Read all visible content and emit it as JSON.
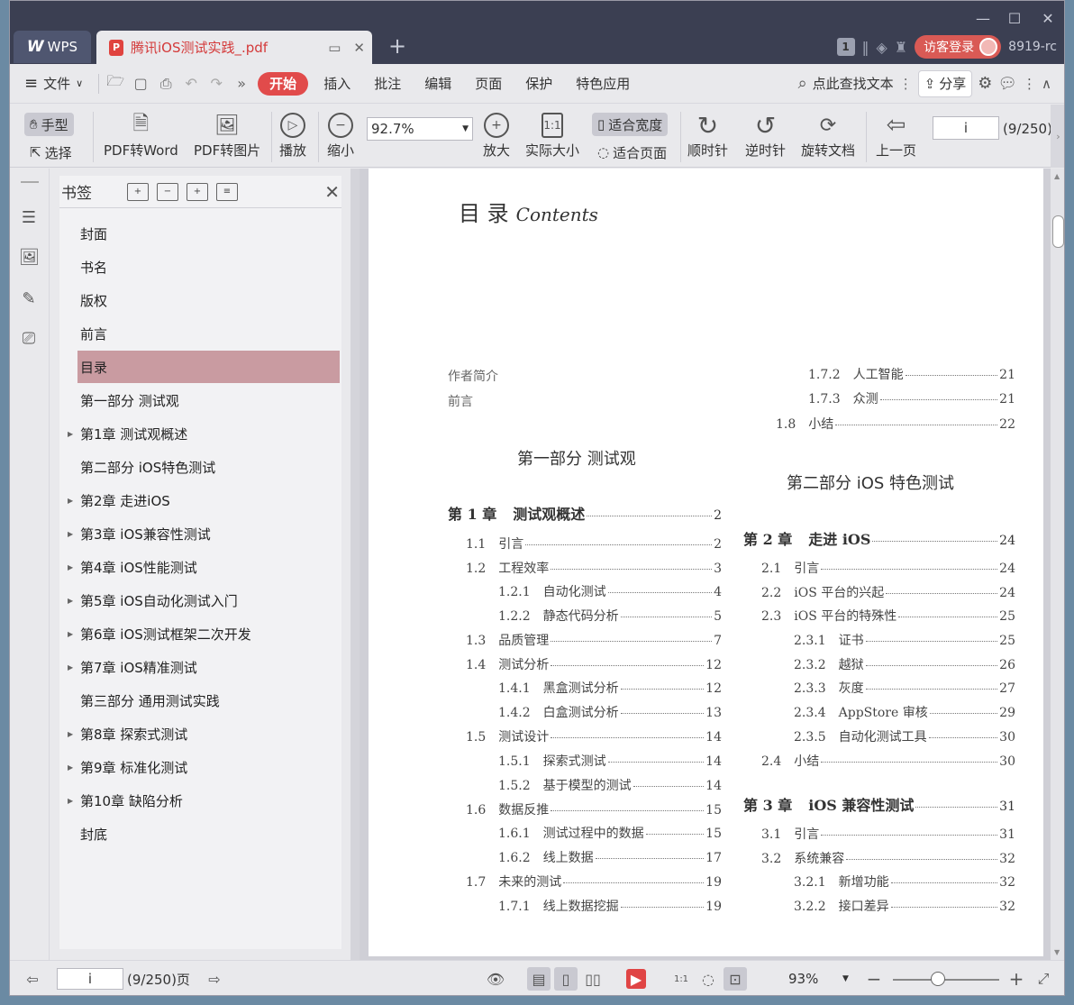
{
  "titlebar": {
    "app_tab": "WPS",
    "app_logo": "W",
    "doc_tab": "腾讯iOS测试实践_.pdf",
    "page_badge": "1",
    "login_label": "访客登录",
    "user": "8919-rc"
  },
  "menu": {
    "file": "文件",
    "tabs": [
      "开始",
      "插入",
      "批注",
      "编辑",
      "页面",
      "保护",
      "特色应用"
    ],
    "search": "点此查找文本",
    "share": "分享"
  },
  "toolbar": {
    "hand": "手型",
    "select": "选择",
    "pdf_to_word": "PDF转Word",
    "pdf_to_image": "PDF转图片",
    "play": "播放",
    "zoom_out": "缩小",
    "zoom_value": "92.7%",
    "zoom_in": "放大",
    "actual_size": "实际大小",
    "fit_width": "适合宽度",
    "fit_page": "适合页面",
    "clockwise": "顺时针",
    "counter_clockwise": "逆时针",
    "rotate_doc": "旋转文档",
    "prev_page": "上一页",
    "page_input": "i",
    "page_count": "(9/250)"
  },
  "bookmarks": {
    "title": "书签",
    "items": [
      {
        "label": "封面",
        "expandable": false
      },
      {
        "label": "书名",
        "expandable": false
      },
      {
        "label": "版权",
        "expandable": false
      },
      {
        "label": "前言",
        "expandable": false
      },
      {
        "label": "目录",
        "expandable": false,
        "selected": true
      },
      {
        "label": "第一部分  测试观",
        "expandable": false
      },
      {
        "label": "第1章  测试观概述",
        "expandable": true
      },
      {
        "label": "第二部分  iOS特色测试",
        "expandable": false
      },
      {
        "label": "第2章  走进iOS",
        "expandable": true
      },
      {
        "label": "第3章  iOS兼容性测试",
        "expandable": true
      },
      {
        "label": "第4章  iOS性能测试",
        "expandable": true
      },
      {
        "label": "第5章  iOS自动化测试入门",
        "expandable": true
      },
      {
        "label": "第6章  iOS测试框架二次开发",
        "expandable": true
      },
      {
        "label": "第7章  iOS精准测试",
        "expandable": true
      },
      {
        "label": "第三部分  通用测试实践",
        "expandable": false
      },
      {
        "label": "第8章  探索式测试",
        "expandable": true
      },
      {
        "label": "第9章  标准化测试",
        "expandable": true
      },
      {
        "label": "第10章  缺陷分析",
        "expandable": true
      },
      {
        "label": "封底",
        "expandable": false
      }
    ]
  },
  "page": {
    "title": "目    录",
    "title_en": "Contents",
    "left_pre": [
      "作者简介",
      "前言"
    ],
    "part1": "第一部分    测试观",
    "part2": "第二部分    iOS 特色测试",
    "left_toc": [
      {
        "num": "第 1 章",
        "text": "测试观概述",
        "page": "2",
        "level": 0
      },
      {
        "num": "1.1",
        "text": "引言",
        "page": "2",
        "level": 1
      },
      {
        "num": "1.2",
        "text": "工程效率",
        "page": "3",
        "level": 1
      },
      {
        "num": "1.2.1",
        "text": "自动化测试",
        "page": "4",
        "level": 2
      },
      {
        "num": "1.2.2",
        "text": "静态代码分析",
        "page": "5",
        "level": 2
      },
      {
        "num": "1.3",
        "text": "品质管理",
        "page": "7",
        "level": 1
      },
      {
        "num": "1.4",
        "text": "测试分析",
        "page": "12",
        "level": 1
      },
      {
        "num": "1.4.1",
        "text": "黑盒测试分析",
        "page": "12",
        "level": 2
      },
      {
        "num": "1.4.2",
        "text": "白盒测试分析",
        "page": "13",
        "level": 2
      },
      {
        "num": "1.5",
        "text": "测试设计",
        "page": "14",
        "level": 1
      },
      {
        "num": "1.5.1",
        "text": "探索式测试",
        "page": "14",
        "level": 2
      },
      {
        "num": "1.5.2",
        "text": "基于模型的测试",
        "page": "14",
        "level": 2
      },
      {
        "num": "1.6",
        "text": "数据反推",
        "page": "15",
        "level": 1
      },
      {
        "num": "1.6.1",
        "text": "测试过程中的数据",
        "page": "15",
        "level": 2
      },
      {
        "num": "1.6.2",
        "text": "线上数据",
        "page": "17",
        "level": 2
      },
      {
        "num": "1.7",
        "text": "未来的测试",
        "page": "19",
        "level": 1
      },
      {
        "num": "1.7.1",
        "text": "线上数据挖掘",
        "page": "19",
        "level": 2
      }
    ],
    "right_top": [
      {
        "num": "1.7.2",
        "text": "人工智能",
        "page": "21",
        "level": 2
      },
      {
        "num": "1.7.3",
        "text": "众测",
        "page": "21",
        "level": 2
      },
      {
        "num": "1.8",
        "text": "小结",
        "page": "22",
        "level": 1
      }
    ],
    "right_toc": [
      {
        "num": "第 2 章",
        "text": "走进 iOS",
        "page": "24",
        "level": 0
      },
      {
        "num": "2.1",
        "text": "引言",
        "page": "24",
        "level": 1
      },
      {
        "num": "2.2",
        "text": "iOS 平台的兴起",
        "page": "24",
        "level": 1
      },
      {
        "num": "2.3",
        "text": "iOS 平台的特殊性",
        "page": "25",
        "level": 1
      },
      {
        "num": "2.3.1",
        "text": "证书",
        "page": "25",
        "level": 2
      },
      {
        "num": "2.3.2",
        "text": "越狱",
        "page": "26",
        "level": 2
      },
      {
        "num": "2.3.3",
        "text": "灰度",
        "page": "27",
        "level": 2
      },
      {
        "num": "2.3.4",
        "text": "AppStore 审核",
        "page": "29",
        "level": 2
      },
      {
        "num": "2.3.5",
        "text": "自动化测试工具",
        "page": "30",
        "level": 2
      },
      {
        "num": "2.4",
        "text": "小结",
        "page": "30",
        "level": 1
      },
      {
        "num": "第 3 章",
        "text": "iOS 兼容性测试",
        "page": "31",
        "level": 0
      },
      {
        "num": "3.1",
        "text": "引言",
        "page": "31",
        "level": 1
      },
      {
        "num": "3.2",
        "text": "系统兼容",
        "page": "32",
        "level": 1
      },
      {
        "num": "3.2.1",
        "text": "新增功能",
        "page": "32",
        "level": 2
      },
      {
        "num": "3.2.2",
        "text": "接口差异",
        "page": "32",
        "level": 2
      }
    ]
  },
  "status": {
    "page_input": "i",
    "page_count": "(9/250)页",
    "zoom": "93%"
  }
}
